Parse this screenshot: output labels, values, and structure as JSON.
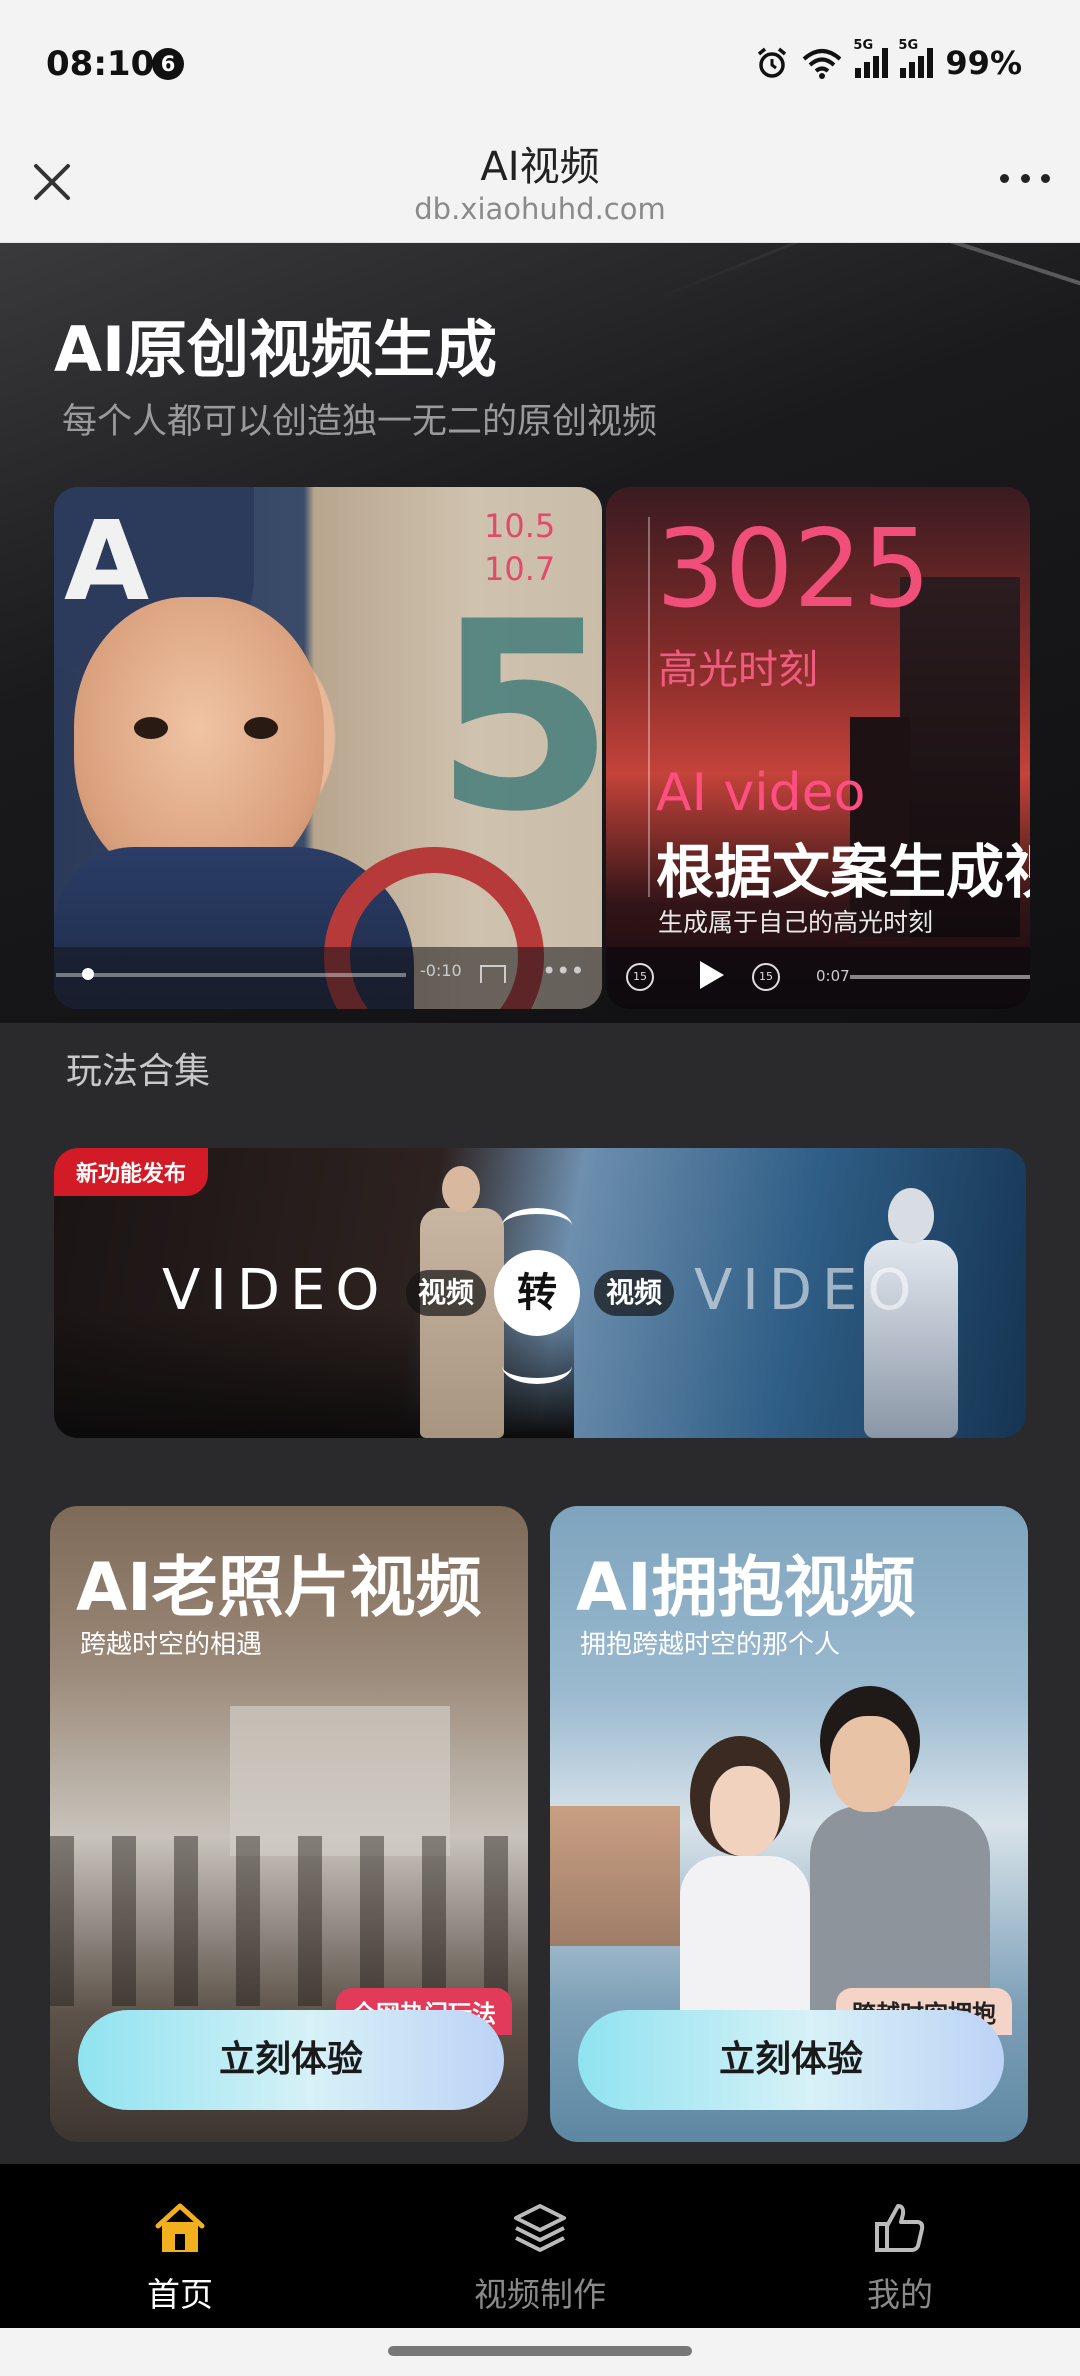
{
  "status_bar": {
    "time": "08:10",
    "notification_count": "6",
    "signal_label_1": "5G",
    "signal_label_2": "5G",
    "battery": "99%"
  },
  "title_bar": {
    "title": "AI视频",
    "domain": "db.xiaohuhd.com",
    "icons": [
      "close-icon",
      "more-icon"
    ]
  },
  "hero": {
    "title": "AI原创视频生成",
    "subtitle": "每个人都可以创造独一无二的原创视频",
    "card1": {
      "date_top": "10.5",
      "date_bottom": "10.7",
      "big_digit": "5",
      "timestamp": "-0:10"
    },
    "card2": {
      "number": "3025",
      "highlight": "高光时刻",
      "ai_video": "AI video",
      "headline": "根据文案生成视",
      "caption": "生成属于自己的高光时刻",
      "rewind": "15",
      "forward": "15",
      "timestamp": "0:07"
    }
  },
  "section": {
    "title": "玩法合集"
  },
  "banner": {
    "tag": "新功能发布",
    "word_left": "VIDEO",
    "word_right": "VIDEO",
    "pill_left": "视频",
    "center": "转",
    "pill_right": "视频"
  },
  "features": [
    {
      "title": "AI老照片视频",
      "description": "跨越时空的相遇",
      "badge": "全网热门玩法",
      "cta": "立刻体验"
    },
    {
      "title": "AI拥抱视频",
      "description": "拥抱跨越时空的那个人",
      "badge": "跨越时空拥抱",
      "cta": "立刻体验"
    }
  ],
  "bottom_nav": {
    "items": [
      {
        "label": "首页",
        "icon": "home-icon",
        "active": true
      },
      {
        "label": "视频制作",
        "icon": "layers-icon",
        "active": false
      },
      {
        "label": "我的",
        "icon": "thumbs-up-icon",
        "active": false
      }
    ],
    "active_color": "#f2b01e"
  }
}
